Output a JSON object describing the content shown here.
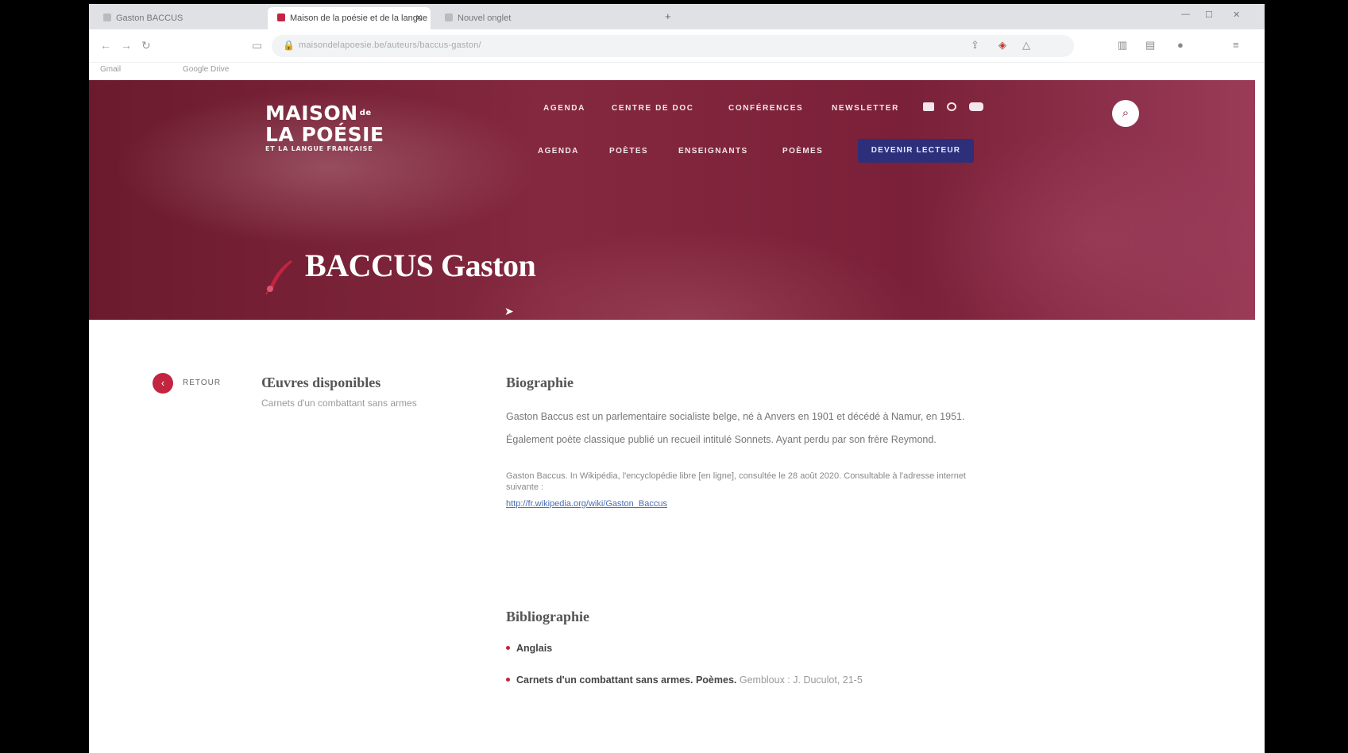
{
  "browser": {
    "tabs": [
      {
        "label": "Gaston BACCUS"
      },
      {
        "label": "Maison de la poésie et de la langue"
      },
      {
        "label": "Nouvel onglet"
      }
    ],
    "url": "maisondelapoesie.be/auteurs/baccus-gaston/",
    "bookmarks": [
      "Gmail",
      "Google Drive"
    ]
  },
  "site": {
    "logo": {
      "line1": "MAISON",
      "line1_sup": "de",
      "line2": "LA POÉSIE",
      "line3": "ET LA LANGUE FRANÇAISE"
    },
    "nav_top": [
      "AGENDA",
      "CENTRE DE DOC",
      "CONFÉRENCES",
      "NEWSLETTER"
    ],
    "nav_main": [
      "AGENDA",
      "POÈTES",
      "ENSEIGNANTS",
      "POÈMES"
    ],
    "cta_label": "DEVENIR LECTEUR",
    "search_icon": "search-icon",
    "social_icons": [
      "facebook-icon",
      "instagram-icon",
      "youtube-icon"
    ],
    "hero_colors": {
      "primary": "#7a2038",
      "accent": "#c3243f",
      "cta": "#2d2f7a"
    }
  },
  "page": {
    "title": "BACCUS Gaston",
    "back_label": "RETOUR",
    "works": {
      "title": "Œuvres disponibles",
      "items": [
        "Carnets d'un combattant sans armes"
      ]
    },
    "biography": {
      "title": "Biographie",
      "text": "Gaston Baccus est un parlementaire socialiste belge, né à Anvers en 1901 et décédé à Namur, en 1951. Également poète classique publié un recueil intitulé Sonnets. Ayant perdu par son frère Reymond.",
      "source": "Gaston Baccus. In Wikipédia, l'encyclopédie libre [en ligne], consultée le 28 août 2020. Consultable à l'adresse internet suivante :",
      "link": "http://fr.wikipedia.org/wiki/Gaston_Baccus"
    },
    "bibliography": {
      "title": "Bibliographie",
      "items": [
        {
          "bold": "Anglais",
          "rest": ""
        },
        {
          "bold": "Carnets d'un combattant sans armes. Poèmes.",
          "rest": "Gembloux : J. Duculot, 21-5"
        }
      ]
    }
  }
}
